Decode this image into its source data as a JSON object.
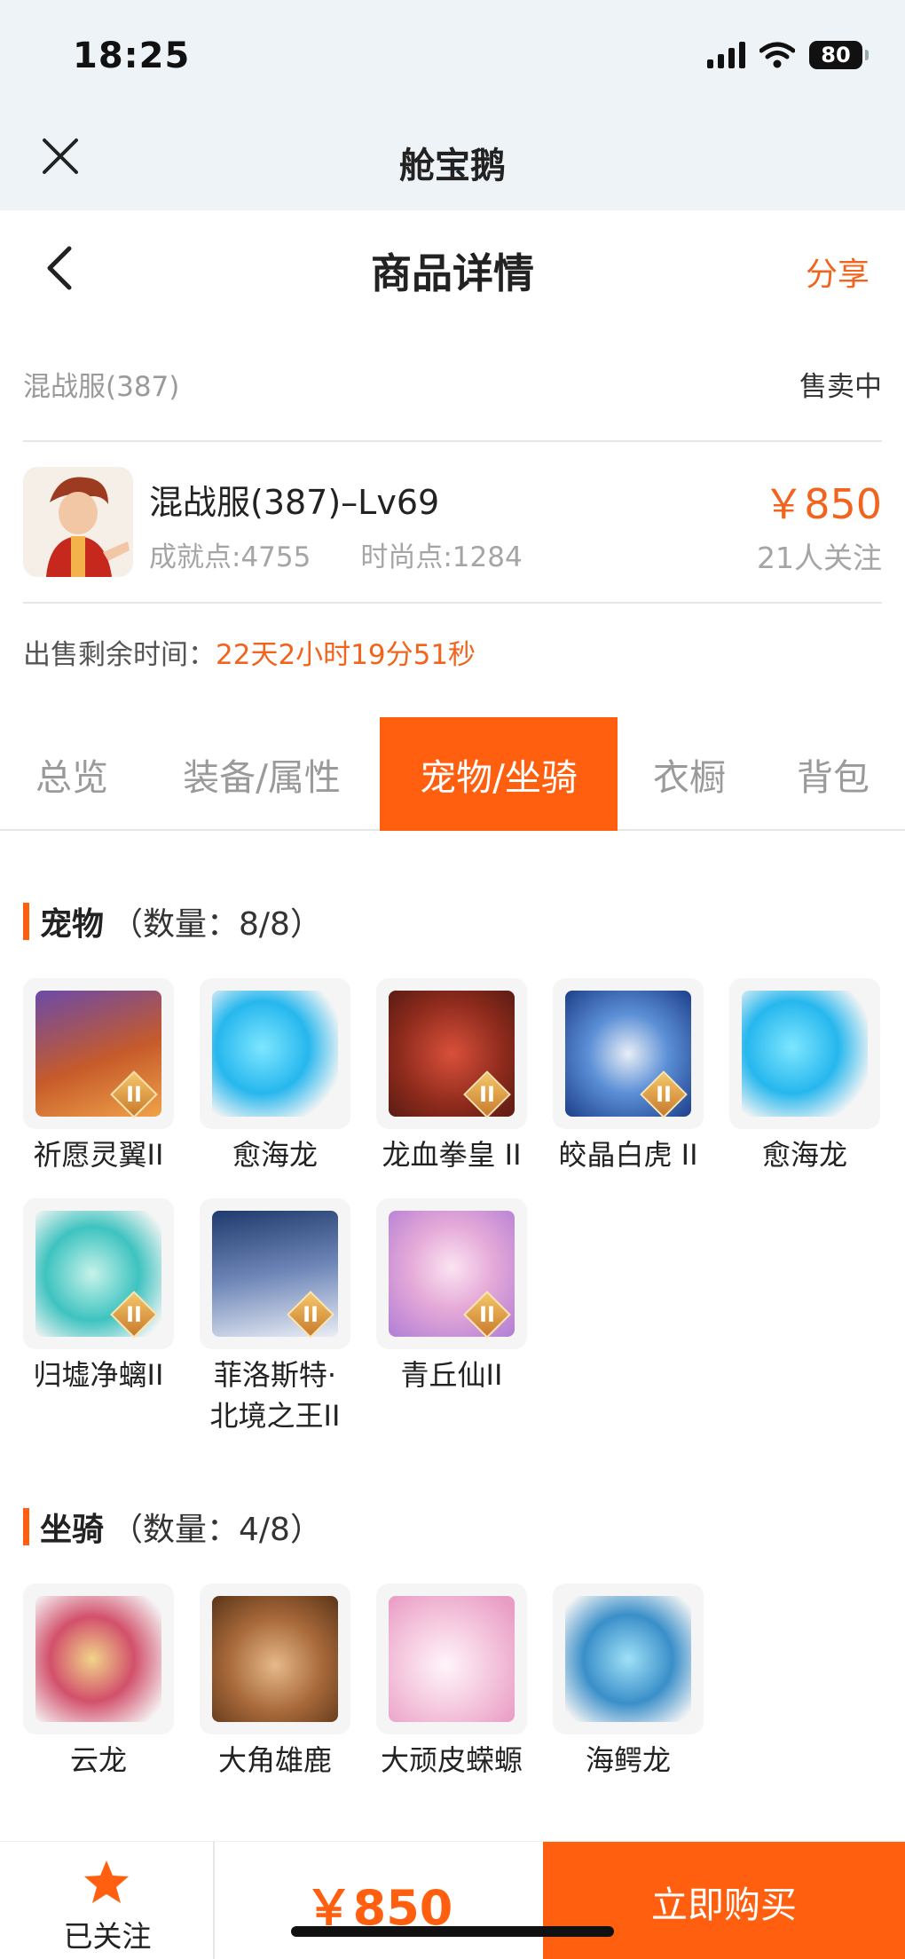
{
  "status_bar": {
    "time": "18:25",
    "battery": "80"
  },
  "app": {
    "title": "舱宝鹅"
  },
  "header": {
    "title": "商品详情",
    "share_label": "分享"
  },
  "listing": {
    "server": "混战服(387)",
    "status": "售卖中",
    "name": "混战服(387)–Lv69",
    "achievement": "成就点:4755",
    "fashion": "时尚点:1284",
    "price": "￥850",
    "follows": "21人关注",
    "remaining_label": "出售剩余时间：",
    "remaining_time": "22天2小时19分51秒"
  },
  "tabs": [
    {
      "label": "总览",
      "active": false
    },
    {
      "label": "装备/属性",
      "active": false
    },
    {
      "label": "宠物/坐骑",
      "active": true
    },
    {
      "label": "衣橱",
      "active": false
    },
    {
      "label": "背包",
      "active": false
    }
  ],
  "pets": {
    "title": "宠物",
    "count": "（数量：8/8）",
    "items": [
      {
        "name": "祈愿灵翼II",
        "badge": "II"
      },
      {
        "name": "愈海龙"
      },
      {
        "name": "龙血拳皇 II",
        "badge": "II"
      },
      {
        "name": "皎晶白虎 II",
        "badge": "II"
      },
      {
        "name": "愈海龙"
      },
      {
        "name": "归墟净螭II",
        "badge": "II"
      },
      {
        "name": "菲洛斯特·北境之王II",
        "badge": "II"
      },
      {
        "name": "青丘仙II",
        "badge": "II"
      }
    ]
  },
  "mounts": {
    "title": "坐骑",
    "count": "（数量：4/8）",
    "items": [
      {
        "name": "云龙"
      },
      {
        "name": "大角雄鹿"
      },
      {
        "name": "大顽皮蝾螈"
      },
      {
        "name": "海鳄龙"
      }
    ]
  },
  "bottom": {
    "follow_label": "已关注",
    "price": "￥850",
    "buy_label": "立即购买"
  },
  "colors": {
    "accent": "#ff5f0e",
    "price": "#f0641e"
  }
}
